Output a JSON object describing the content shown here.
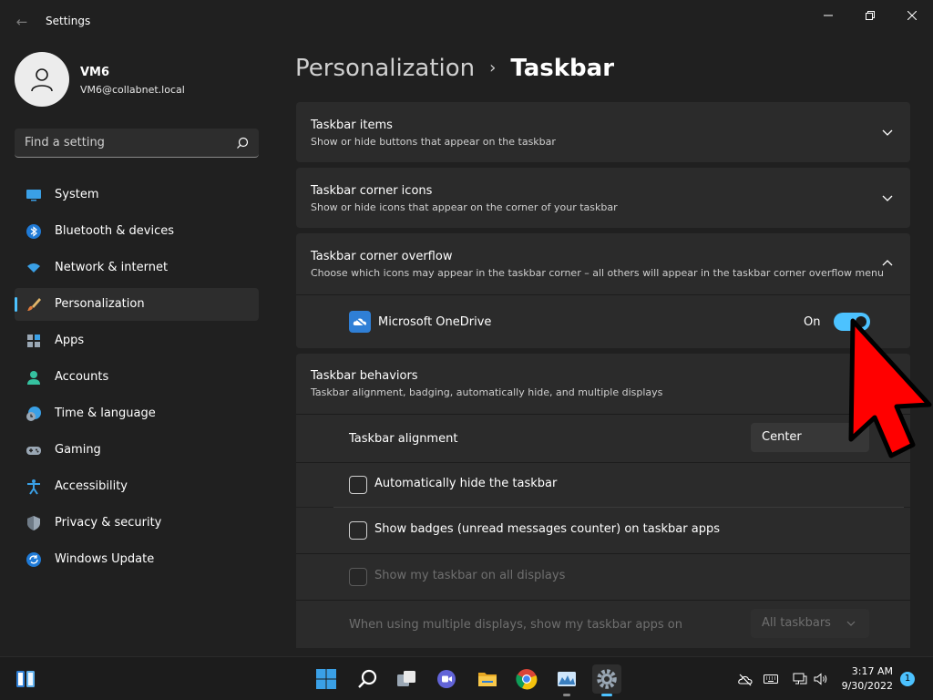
{
  "window": {
    "title": "Settings",
    "back_glyph": "←"
  },
  "profile": {
    "name": "VM6",
    "email": "VM6@collabnet.local"
  },
  "search": {
    "placeholder": "Find a setting"
  },
  "nav": {
    "items": [
      {
        "label": "System",
        "icon": "monitor-icon"
      },
      {
        "label": "Bluetooth & devices",
        "icon": "bluetooth-icon"
      },
      {
        "label": "Network & internet",
        "icon": "wifi-icon"
      },
      {
        "label": "Personalization",
        "icon": "brush-icon",
        "active": true
      },
      {
        "label": "Apps",
        "icon": "apps-icon"
      },
      {
        "label": "Accounts",
        "icon": "person-icon"
      },
      {
        "label": "Time & language",
        "icon": "clock-globe-icon"
      },
      {
        "label": "Gaming",
        "icon": "gamepad-icon"
      },
      {
        "label": "Accessibility",
        "icon": "accessibility-icon"
      },
      {
        "label": "Privacy & security",
        "icon": "shield-icon"
      },
      {
        "label": "Windows Update",
        "icon": "update-icon"
      }
    ]
  },
  "breadcrumb": {
    "parent": "Personalization",
    "separator": "›",
    "current": "Taskbar"
  },
  "sections": {
    "taskbar_items": {
      "title": "Taskbar items",
      "desc": "Show or hide buttons that appear on the taskbar"
    },
    "corner_icons": {
      "title": "Taskbar corner icons",
      "desc": "Show or hide icons that appear on the corner of your taskbar"
    },
    "corner_overflow": {
      "title": "Taskbar corner overflow",
      "desc": "Choose which icons may appear in the taskbar corner – all others will appear in the taskbar corner overflow menu",
      "onedrive": {
        "label": "Microsoft OneDrive",
        "state": "On"
      }
    },
    "behaviors": {
      "title": "Taskbar behaviors",
      "desc": "Taskbar alignment, badging, automatically hide, and multiple displays",
      "alignment_label": "Taskbar alignment",
      "alignment_value": "Center",
      "auto_hide": "Automatically hide the taskbar",
      "badges": "Show badges (unread messages counter) on taskbar apps",
      "all_displays": "Show my taskbar on all displays",
      "multi_display_label": "When using multiple displays, show my taskbar apps on",
      "multi_display_value": "All taskbars"
    }
  },
  "taskbar": {
    "time": "3:17 AM",
    "date": "9/30/2022",
    "notification_count": "1"
  },
  "colors": {
    "accent": "#4cc2ff",
    "cursor": "#ff0000"
  }
}
